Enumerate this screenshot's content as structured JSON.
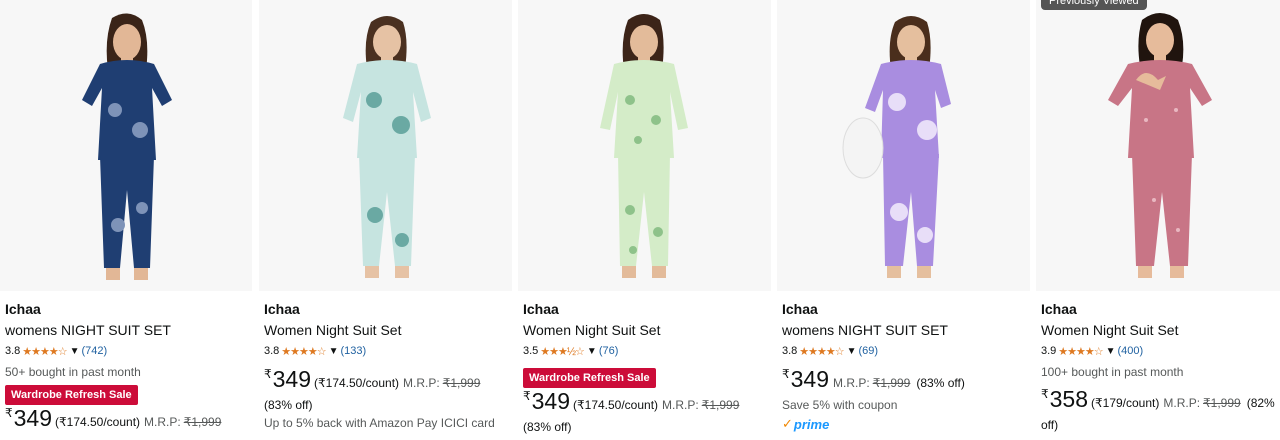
{
  "products": [
    {
      "brand": "Ichaa",
      "title": "womens NIGHT SUIT SET",
      "rating": "3.8",
      "stars": "★★★★☆",
      "review_count": "(742)",
      "bought": "50+ bought in past month",
      "badge": "Wardrobe Refresh Sale",
      "currency": "₹",
      "price": "349",
      "unit_price": "(₹174.50/count)",
      "mrp_label": "M.R.P:",
      "mrp": "₹1,999",
      "suit_color": "#1f3e72",
      "print_color": "#7e93b8"
    },
    {
      "brand": "Ichaa",
      "title": "Women Night Suit Set",
      "rating": "3.8",
      "stars": "★★★★☆",
      "review_count": "(133)",
      "currency": "₹",
      "price": "349",
      "unit_price": "(₹174.50/count)",
      "mrp_label": "M.R.P:",
      "mrp": "₹1,999",
      "discount": "(83% off)",
      "offer": "Up to 5% back with Amazon Pay ICICI card",
      "suit_color": "#c6e4e0",
      "print_color": "#6aa9a3"
    },
    {
      "brand": "Ichaa",
      "title": "Women Night Suit Set",
      "rating": "3.5",
      "stars": "★★★½☆",
      "review_count": "(76)",
      "badge": "Wardrobe Refresh Sale",
      "currency": "₹",
      "price": "349",
      "unit_price": "(₹174.50/count)",
      "mrp_label": "M.R.P:",
      "mrp": "₹1,999",
      "discount": "(83% off)",
      "suit_color": "#d4ecc8",
      "print_color": "#8ec28a"
    },
    {
      "brand": "Ichaa",
      "title": "womens NIGHT SUIT SET",
      "rating": "3.8",
      "stars": "★★★★☆",
      "review_count": "(69)",
      "currency": "₹",
      "price": "349",
      "mrp_label": "M.R.P:",
      "mrp": "₹1,999",
      "discount": "(83% off)",
      "coupon": "Save 5% with coupon",
      "prime": "prime",
      "suit_color": "#a98de0",
      "print_color": "#e8def8"
    },
    {
      "previously_viewed": "Previously Viewed",
      "brand": "Ichaa",
      "title": "Women Night Suit Set",
      "rating": "3.9",
      "stars": "★★★★☆",
      "review_count": "(400)",
      "bought": "100+ bought in past month",
      "currency": "₹",
      "price": "358",
      "unit_price": "(₹179/count)",
      "mrp_label": "M.R.P:",
      "mrp": "₹1,999",
      "discount": "(82%",
      "discount_cont": "off)",
      "suit_color": "#c87586",
      "print_color": "#e9b7c1"
    }
  ]
}
